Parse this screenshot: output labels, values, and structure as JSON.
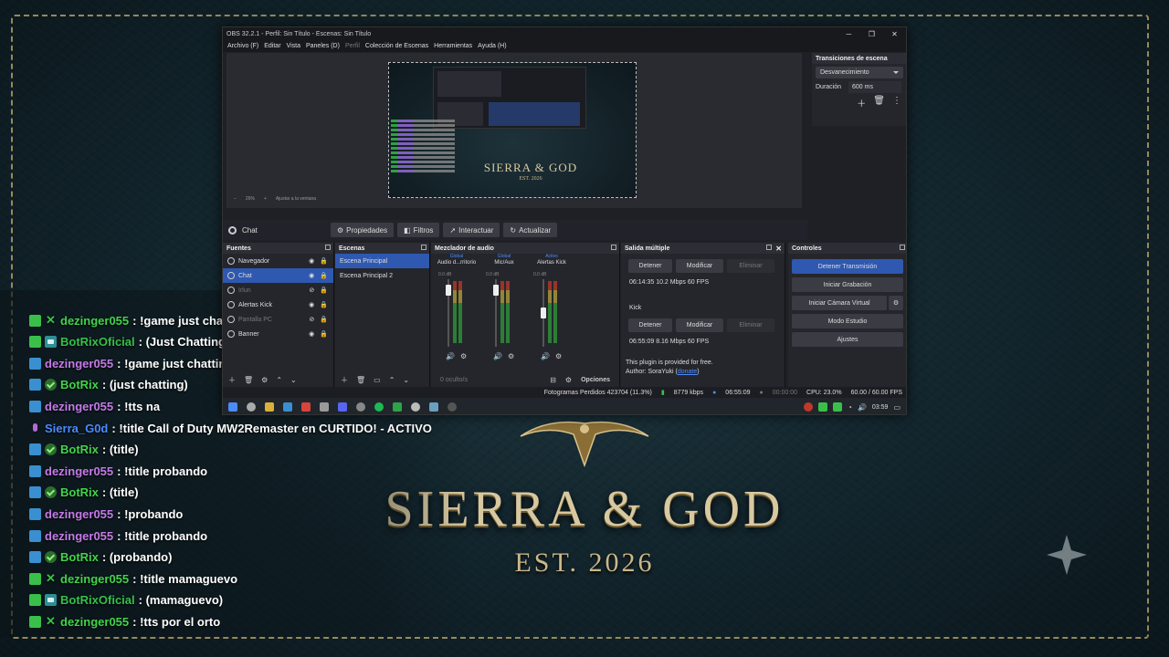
{
  "background": {
    "brand_title": "SIERRA & GOD",
    "brand_subtitle": "EST. 2026",
    "accent_gold": "#d8c8a0",
    "bg_color": "#13262e"
  },
  "chat": {
    "lines": [
      {
        "badges": [
          "green",
          "x"
        ],
        "user": "dezinger055",
        "user_color": "#43d34a",
        "text": ": !game just chatting"
      },
      {
        "badges": [
          "green",
          "cam"
        ],
        "user": "BotRixOficial",
        "user_color": "#35c04a",
        "text": ": (Just Chatting)"
      },
      {
        "badges": [
          "blue"
        ],
        "user": "dezinger055",
        "user_color": "#c47ae8",
        "text": ": !game just chatting"
      },
      {
        "badges": [
          "blue",
          "chk"
        ],
        "user": "BotRix",
        "user_color": "#43d34a",
        "text": ": (just chatting)"
      },
      {
        "badges": [
          "blue"
        ],
        "user": "dezinger055",
        "user_color": "#c47ae8",
        "text": ": !tts na"
      },
      {
        "badges": [
          "mic"
        ],
        "user": "Sierra_G0d",
        "user_color": "#4b8bff",
        "text": ": !title Call of Duty MW2Remaster en CURTIDO! - ACTIVO"
      },
      {
        "badges": [
          "blue",
          "chk"
        ],
        "user": "BotRix",
        "user_color": "#43d34a",
        "text": ": (title)"
      },
      {
        "badges": [
          "blue"
        ],
        "user": "dezinger055",
        "user_color": "#c47ae8",
        "text": ": !title probando"
      },
      {
        "badges": [
          "blue",
          "chk"
        ],
        "user": "BotRix",
        "user_color": "#43d34a",
        "text": ": (title)"
      },
      {
        "badges": [
          "blue"
        ],
        "user": "dezinger055",
        "user_color": "#c47ae8",
        "text": ": !probando"
      },
      {
        "badges": [
          "blue"
        ],
        "user": "dezinger055",
        "user_color": "#c47ae8",
        "text": ": !title probando"
      },
      {
        "badges": [
          "blue",
          "chk"
        ],
        "user": "BotRix",
        "user_color": "#43d34a",
        "text": ": (probando)"
      },
      {
        "badges": [
          "green",
          "x"
        ],
        "user": "dezinger055",
        "user_color": "#43d34a",
        "text": ": !title mamaguevo"
      },
      {
        "badges": [
          "green",
          "cam"
        ],
        "user": "BotRixOficial",
        "user_color": "#35c04a",
        "text": ": (mamaguevo)"
      },
      {
        "badges": [
          "green",
          "x"
        ],
        "user": "dezinger055",
        "user_color": "#43d34a",
        "text": ": !tts por el orto"
      }
    ]
  },
  "obs": {
    "title": "OBS 32.2.1 - Perfil: Sin Título - Escenas: Sin Título",
    "menu": [
      "Archivo (F)",
      "Editar",
      "Vista",
      "Paneles (D)",
      "Perfil",
      "Colección de Escenas",
      "Herramientas",
      "Ayuda (H)"
    ],
    "preview": {
      "zoom": "26%",
      "fit": "Ajustar a la ventana"
    },
    "transitions": {
      "header": "Transiciones de escena",
      "selected": "Desvanecimiento",
      "duration_label": "Duración",
      "duration_value": "600 ms"
    },
    "source_bar": {
      "selected_source": "Chat",
      "props": "Propiedades",
      "filters": "Filtros",
      "interact": "Interactuar",
      "refresh": "Actualizar"
    },
    "sources": {
      "header": "Fuentes",
      "items": [
        {
          "name": "Navegador",
          "selected": false,
          "hidden": false
        },
        {
          "name": "Chat",
          "selected": true,
          "hidden": false
        },
        {
          "name": "Irlun",
          "selected": false,
          "hidden": true
        },
        {
          "name": "Alertas Kick",
          "selected": false,
          "hidden": false
        },
        {
          "name": "Pantalla PC",
          "selected": false,
          "hidden": true
        },
        {
          "name": "Banner",
          "selected": false,
          "hidden": false
        }
      ]
    },
    "scenes": {
      "header": "Escenas",
      "items": [
        "Escena Principal",
        "Escena Principal 2"
      ]
    },
    "mixer": {
      "header": "Mezclador de audio",
      "channels": [
        {
          "group": "Global",
          "name": "Audio d...rritorio",
          "db": "0.0 dB",
          "level": 0.9
        },
        {
          "group": "Global",
          "name": "Mic/Aux",
          "db": "0.0 dB",
          "level": 0.9
        },
        {
          "group": "Activo",
          "name": "Alertas Kick",
          "db": "0.0 dB",
          "level": 0.5
        }
      ],
      "hidden": "0 oculto/s",
      "options": "Opciones"
    },
    "output": {
      "header": "Salida múltiple",
      "stop": "Detener",
      "modify": "Modificar",
      "remove": "Eliminar",
      "target1_stats": "06:14:35  10.2 Mbps  60 FPS",
      "target2_name": "Kick",
      "target2_stats": "06:55:09  8.16 Mbps  60 FPS",
      "plugin_note": "This plugin is provided for free.",
      "author_prefix": "Author: SoraYuki (",
      "author_link": "donate",
      "author_suffix": ")"
    },
    "controls": {
      "header": "Controles",
      "stop_stream": "Detener Transmisión",
      "start_rec": "Iniciar Grabación",
      "virtual_cam": "Iniciar Cámara Virtual",
      "studio": "Modo Estudio",
      "settings": "Ajustes"
    },
    "status": {
      "dropped": "Fotogramas Perdidos 423704 (11.3%)",
      "bitrate": "8779 kbps",
      "stream_time": "06:55:09",
      "rec_time": "00:00:00",
      "cpu": "CPU: 23.0%",
      "fps": "60.00 / 60.00 FPS"
    },
    "taskbar": {
      "time": "03:59"
    }
  }
}
